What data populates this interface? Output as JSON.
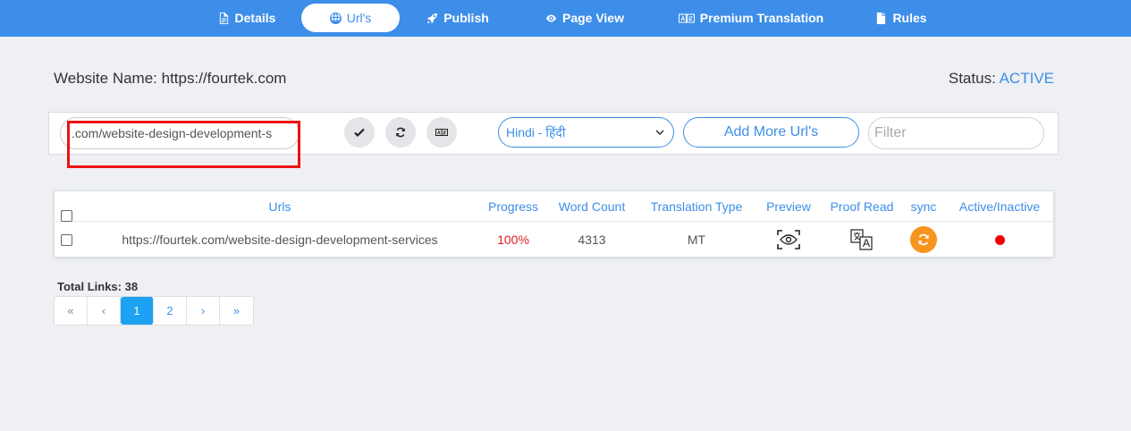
{
  "nav": {
    "tabs": [
      {
        "label": "Details",
        "icon": "document-icon"
      },
      {
        "label": "Url's",
        "icon": "globe-icon"
      },
      {
        "label": "Publish",
        "icon": "rocket-icon"
      },
      {
        "label": "Page View",
        "icon": "eye-icon"
      },
      {
        "label": "Premium Translation",
        "icon": "translate-icon"
      },
      {
        "label": "Rules",
        "icon": "file-icon"
      }
    ],
    "active_tab": "Url's",
    "accent_color": "#3d8ee8"
  },
  "header": {
    "website_label": "Website Name: https://fourtek.com",
    "status_label": "Status:",
    "status_value": "ACTIVE"
  },
  "toolbar": {
    "url_value": ".com/website-design-development-s",
    "language": "Hindi - हिंदी",
    "add_more_label": "Add More Url's",
    "filter_placeholder": "Filter"
  },
  "table": {
    "columns": [
      "Urls",
      "Progress",
      "Word Count",
      "Translation Type",
      "Preview",
      "Proof Read",
      "sync",
      "Active/Inactive"
    ],
    "rows": [
      {
        "url": "https://fourtek.com/website-design-development-services",
        "progress": "100%",
        "word_count": "4313",
        "translation_type": "MT",
        "active_status_color": "#ee0000"
      }
    ]
  },
  "footer": {
    "total_links": "Total Links: 38",
    "pages": [
      "«",
      "‹",
      "1",
      "2",
      "›",
      "»"
    ],
    "current_page": "1"
  }
}
